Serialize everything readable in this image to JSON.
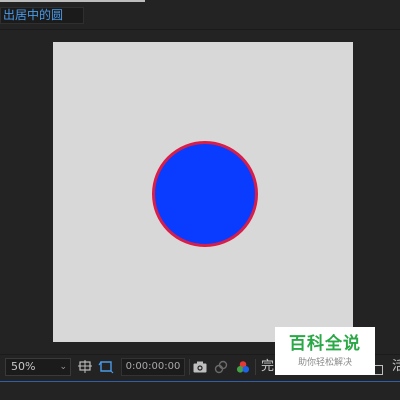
{
  "composition_tab": {
    "label": "出居中的圆"
  },
  "canvas": {
    "background": "#d8d8d8",
    "circle_fill": "#0a3cff",
    "circle_stroke": "#d81e48"
  },
  "toolbar": {
    "zoom_value": "50%",
    "zoom_chevron": "⌄",
    "timecode": "0:00:00:00",
    "resolution_label": "完",
    "cutoff_label": "活",
    "icons": [
      "region-of-interest-icon",
      "transparency-grid-icon",
      "snapshot-camera-icon",
      "show-snapshot-icon",
      "color-channels-icon",
      "grid-square-icon"
    ]
  },
  "watermark": {
    "title": "百科全说",
    "subtitle": "助你轻松解决"
  },
  "colors": {
    "accent_blue": "#4a9ae8",
    "watermark_green": "#2aa846"
  }
}
